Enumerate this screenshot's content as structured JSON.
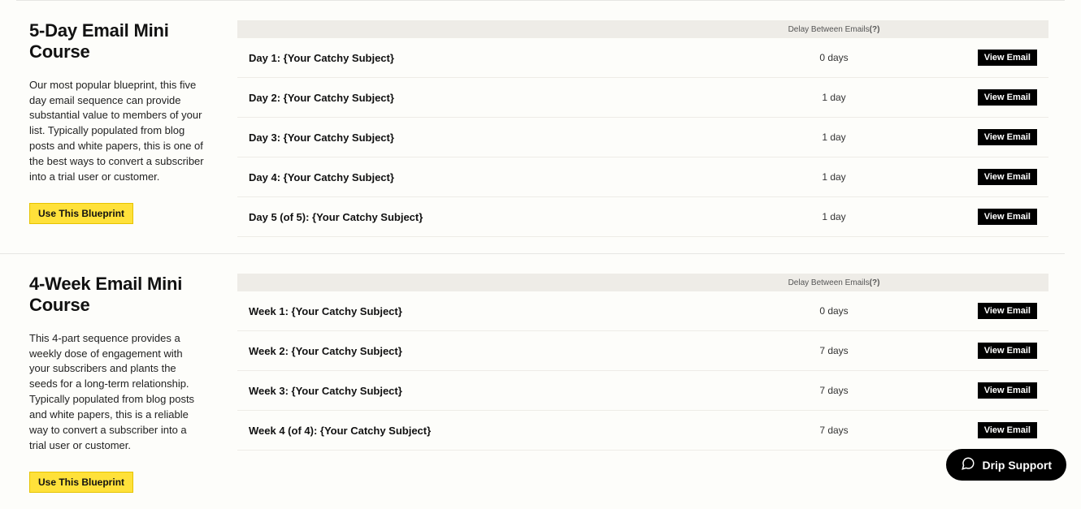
{
  "actions": {
    "use_blueprint_label": "Use This Blueprint",
    "view_email_label": "View Email"
  },
  "table_header": {
    "delay_label": "Delay Between Emails",
    "help": "(?)"
  },
  "blueprints": [
    {
      "title": "5-Day Email Mini Course",
      "description": "Our most popular blueprint, this five day email sequence can provide substantial value to members of your list. Typically populated from blog posts and white papers, this is one of the best ways to convert a subscriber into a trial user or customer.",
      "rows": [
        {
          "subject": "Day 1: {Your Catchy Subject}",
          "delay": "0 days"
        },
        {
          "subject": "Day 2: {Your Catchy Subject}",
          "delay": "1 day"
        },
        {
          "subject": "Day 3: {Your Catchy Subject}",
          "delay": "1 day"
        },
        {
          "subject": "Day 4: {Your Catchy Subject}",
          "delay": "1 day"
        },
        {
          "subject": "Day 5 (of 5): {Your Catchy Subject}",
          "delay": "1 day"
        }
      ]
    },
    {
      "title": "4-Week Email Mini Course",
      "description": "This 4-part sequence provides a weekly dose of engagement with your subscribers and plants the seeds for a long-term relationship. Typically populated from blog posts and white papers, this is a reliable way to convert a subscriber into a trial user or customer.",
      "rows": [
        {
          "subject": "Week 1: {Your Catchy Subject}",
          "delay": "0 days"
        },
        {
          "subject": "Week 2: {Your Catchy Subject}",
          "delay": "7 days"
        },
        {
          "subject": "Week 3: {Your Catchy Subject}",
          "delay": "7 days"
        },
        {
          "subject": "Week 4 (of 4): {Your Catchy Subject}",
          "delay": "7 days"
        }
      ]
    }
  ],
  "support": {
    "label": "Drip Support"
  }
}
